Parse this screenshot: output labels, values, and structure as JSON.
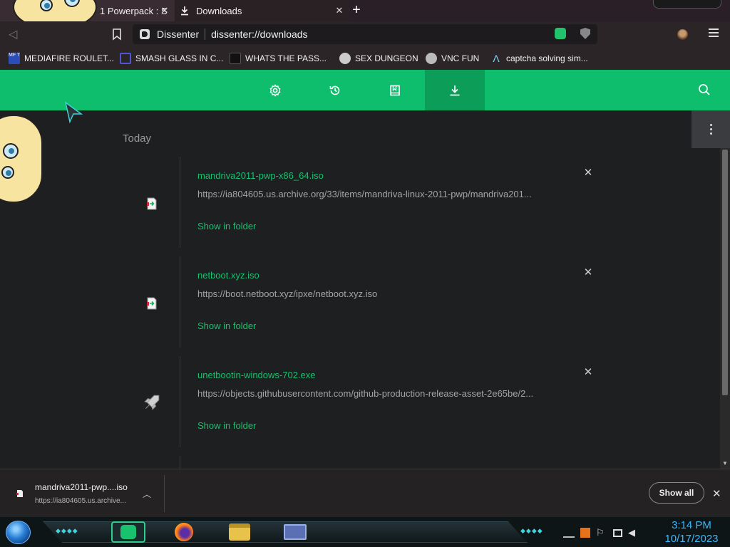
{
  "tabs": [
    {
      "label": "1 Powerpack : S"
    },
    {
      "label": "Downloads"
    }
  ],
  "toolbar": {
    "site_name": "Dissenter",
    "url": "dissenter://downloads"
  },
  "bookmarks": [
    {
      "label": "MEDIAFIRE ROULET...",
      "icon": "mediafire-icon"
    },
    {
      "label": "SMASH GLASS IN C...",
      "icon": "smash-icon"
    },
    {
      "label": "WHATS THE PASS...",
      "icon": "pass-icon"
    },
    {
      "label": "SEX DUNGEON",
      "icon": "dungeon-icon"
    },
    {
      "label": "VNC FUN",
      "icon": "vnc-icon"
    },
    {
      "label": "captcha solving sim...",
      "icon": "captcha-icon"
    }
  ],
  "header": {
    "nav": [
      "settings-icon",
      "history-icon",
      "bookmarks-icon",
      "downloads-icon"
    ],
    "active": "downloads",
    "accent": "#0fbe6c"
  },
  "downloads": {
    "section_label": "Today",
    "show_in_folder": "Show in folder",
    "items": [
      {
        "name": "mandriva2011-pwp-x86_64.iso",
        "url": "https://ia804605.us.archive.org/33/items/mandriva-linux-2011-pwp/mandriva201..."
      },
      {
        "name": "netboot.xyz.iso",
        "url": "https://boot.netboot.xyz/ipxe/netboot.xyz.iso"
      },
      {
        "name": "unetbootin-windows-702.exe",
        "url": "https://objects.githubusercontent.com/github-production-release-asset-2e65be/2..."
      }
    ]
  },
  "shelf": {
    "file_name": "mandriva2011-pwp....iso",
    "file_url": "https://ia804605.us.archive...",
    "show_all": "Show all"
  },
  "taskbar": {
    "time": "3:14 PM",
    "date": "10/17/2023"
  }
}
